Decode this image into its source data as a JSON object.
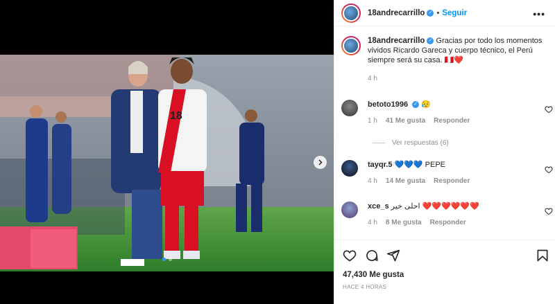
{
  "post": {
    "username": "18andrecarrillo",
    "follow_label": "Seguir",
    "separator": "•",
    "caption_text": "Gracias por todo los momentos vividos Ricardo Gareca y cuerpo técnico, el Perú siempre será su casa. 🇵🇪❤️",
    "caption_time": "4 h",
    "jersey_number": "18",
    "likes": "47,430 Me gusta",
    "date": "HACE 4 HORAS"
  },
  "comments": [
    {
      "username": "betoto1996",
      "verified": true,
      "text": "😥",
      "time": "1 h",
      "likes": "41 Me gusta",
      "reply": "Responder"
    },
    {
      "username": "tayqr.5",
      "verified": false,
      "text": "💙💙💙 PEPE",
      "time": "4 h",
      "likes": "14 Me gusta",
      "reply": "Responder"
    },
    {
      "username": "xce_s",
      "verified": false,
      "text": "احلى خير ❤️❤️❤️❤️❤️❤️",
      "time": "4 h",
      "likes": "8 Me gusta",
      "reply": "Responder"
    }
  ],
  "view_replies": "Ver respuestas (6)",
  "colors": {
    "accent": "#0095f6",
    "heart": "#ed4956",
    "peru_red": "#d91023"
  },
  "icons": [
    "more-icon",
    "verified-icon",
    "heart-icon",
    "comment-icon",
    "share-icon",
    "bookmark-icon",
    "chevron-right-icon"
  ]
}
